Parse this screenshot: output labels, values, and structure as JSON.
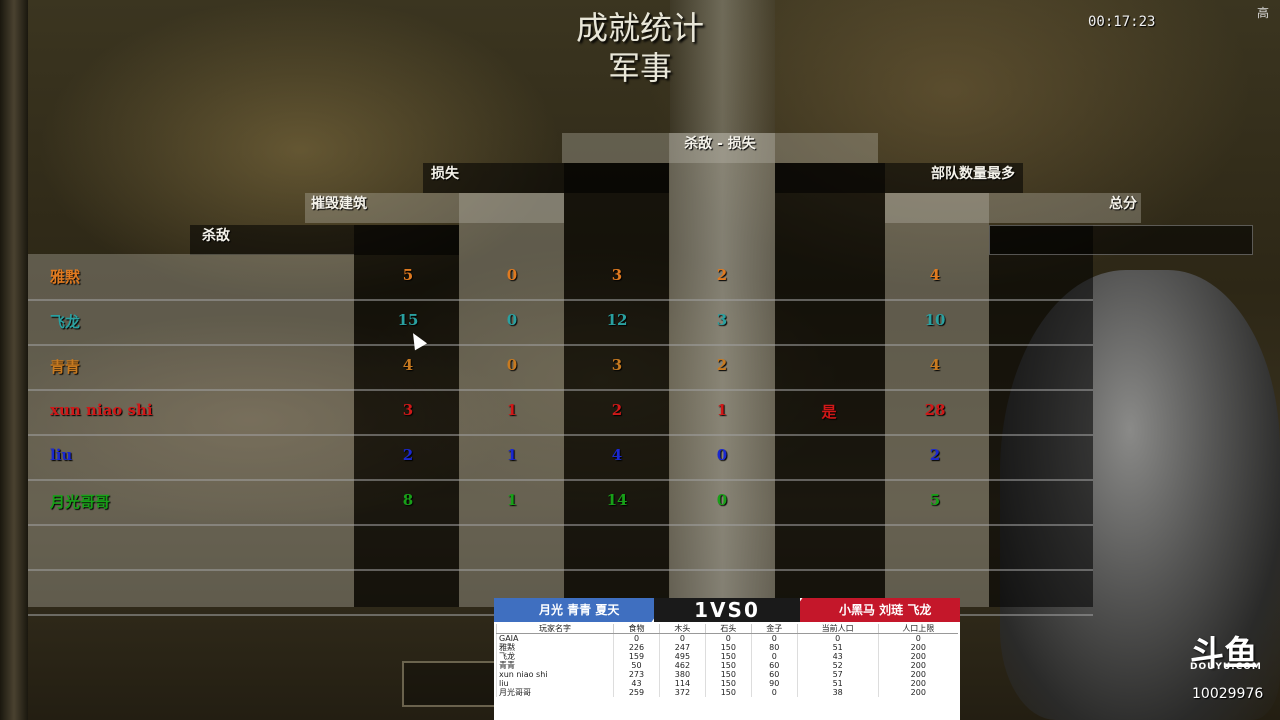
{
  "header": {
    "title": "成就统计",
    "subtitle": "军事",
    "timer": "00:17:23",
    "corner_label": "高"
  },
  "columns": {
    "kills": "杀敌",
    "razed": "摧毁建筑",
    "losses": "损失",
    "kd": "杀敌 - 损失",
    "largest_army": "部队数量最多",
    "score": "总分"
  },
  "players": [
    {
      "name": "雅黙",
      "color": "#e07a20",
      "kills": "5",
      "razed": "0",
      "losses": "3",
      "kd": "2",
      "largest": "",
      "score": "4"
    },
    {
      "name": "飞龙",
      "color": "#2aa0a0",
      "kills": "15",
      "razed": "0",
      "losses": "12",
      "kd": "3",
      "largest": "",
      "score": "10"
    },
    {
      "name": "青青",
      "color": "#c87a20",
      "kills": "4",
      "razed": "0",
      "losses": "3",
      "kd": "2",
      "largest": "",
      "score": "4"
    },
    {
      "name": "xun niao shi",
      "color": "#d01818",
      "kills": "3",
      "razed": "1",
      "losses": "2",
      "kd": "1",
      "largest": "是",
      "score": "28"
    },
    {
      "name": "liu",
      "color": "#1a28d0",
      "kills": "2",
      "razed": "1",
      "losses": "4",
      "kd": "0",
      "largest": "",
      "score": "2"
    },
    {
      "name": "月光哥哥",
      "color": "#18a018",
      "kills": "8",
      "razed": "1",
      "losses": "14",
      "kd": "0",
      "largest": "",
      "score": "5"
    }
  ],
  "overlay": {
    "left_team": "月光  青青  夏天",
    "score": "1VS0",
    "right_team": "小黑马  刘琏  飞龙",
    "headers": [
      "玩家名字",
      "食物",
      "木头",
      "石头",
      "金子",
      "当前人口",
      "人口上限"
    ],
    "rows": [
      [
        "GAIA",
        "0",
        "0",
        "0",
        "0",
        "0",
        "0"
      ],
      [
        "雅黙",
        "226",
        "247",
        "150",
        "80",
        "51",
        "200"
      ],
      [
        "飞龙",
        "159",
        "495",
        "150",
        "0",
        "43",
        "200"
      ],
      [
        "青青",
        "50",
        "462",
        "150",
        "60",
        "52",
        "200"
      ],
      [
        "xun niao shi",
        "273",
        "380",
        "150",
        "60",
        "57",
        "200"
      ],
      [
        "liu",
        "43",
        "114",
        "150",
        "90",
        "51",
        "200"
      ],
      [
        "月光哥哥",
        "259",
        "372",
        "150",
        "0",
        "38",
        "200"
      ]
    ]
  },
  "watermark": {
    "logo": "斗鱼",
    "site": "DOUYU.COM",
    "room_id": "10029976"
  }
}
